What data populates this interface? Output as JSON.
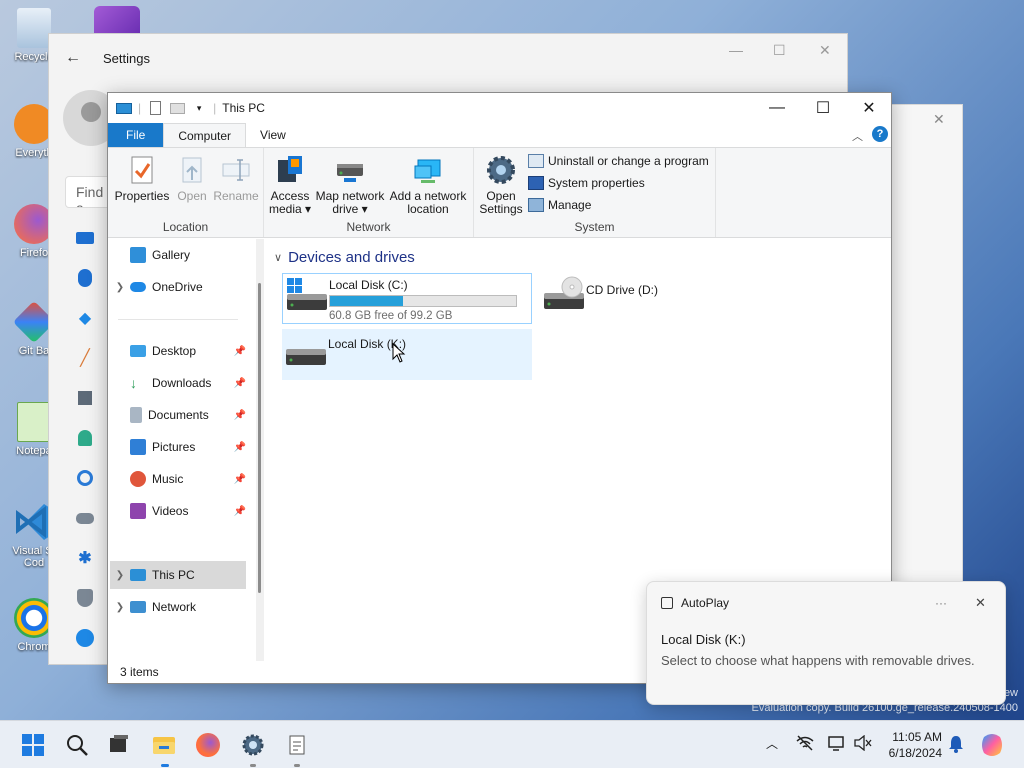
{
  "desktop": {
    "icons": [
      {
        "label": "Recycle"
      },
      {
        "label": "Everyth"
      },
      {
        "label": "Firefo"
      },
      {
        "label": "Git Ba"
      },
      {
        "label": "Notepa"
      },
      {
        "label": "Visual St"
      },
      {
        "label": "Cod"
      },
      {
        "label": "Chrom"
      }
    ]
  },
  "settings": {
    "title": "Settings",
    "search_placeholder": "Find a"
  },
  "explorer": {
    "title": "This PC",
    "tabs": {
      "file": "File",
      "computer": "Computer",
      "view": "View"
    },
    "ribbon": {
      "location": {
        "label": "Location",
        "properties": "Properties",
        "open": "Open",
        "rename": "Rename"
      },
      "network": {
        "label": "Network",
        "access_media_1": "Access",
        "access_media_2": "media ▾",
        "map_drive_1": "Map network",
        "map_drive_2": "drive ▾",
        "add_location_1": "Add a network",
        "add_location_2": "location"
      },
      "system": {
        "label": "System",
        "open_settings_1": "Open",
        "open_settings_2": "Settings",
        "uninstall": "Uninstall or change a program",
        "system_properties": "System properties",
        "manage": "Manage"
      }
    },
    "nav": {
      "gallery": "Gallery",
      "onedrive": "OneDrive",
      "desktop": "Desktop",
      "downloads": "Downloads",
      "documents": "Documents",
      "pictures": "Pictures",
      "music": "Music",
      "videos": "Videos",
      "this_pc": "This PC",
      "network": "Network"
    },
    "content": {
      "group_title": "Devices and drives",
      "drive_c": {
        "name": "Local Disk (C:)",
        "free": "60.8 GB free of 99.2 GB",
        "used_fraction": 0.39
      },
      "drive_d": {
        "name": "CD Drive (D:)"
      },
      "drive_k": {
        "name": "Local Disk (K:)"
      }
    },
    "status": "3 items"
  },
  "toast": {
    "app": "AutoPlay",
    "more": "···",
    "title": "Local Disk (K:)",
    "text": "Select to choose what happens with removable drives."
  },
  "watermark": {
    "line1": "ew",
    "line2": "Evaluation copy. Build 26100.ge_release.240508-1400"
  },
  "taskbar": {
    "time": "11:05 AM",
    "date": "6/18/2024"
  },
  "colors": {
    "accent": "#1979ca",
    "progress": "#26a0da",
    "selection": "#cce4f7"
  }
}
